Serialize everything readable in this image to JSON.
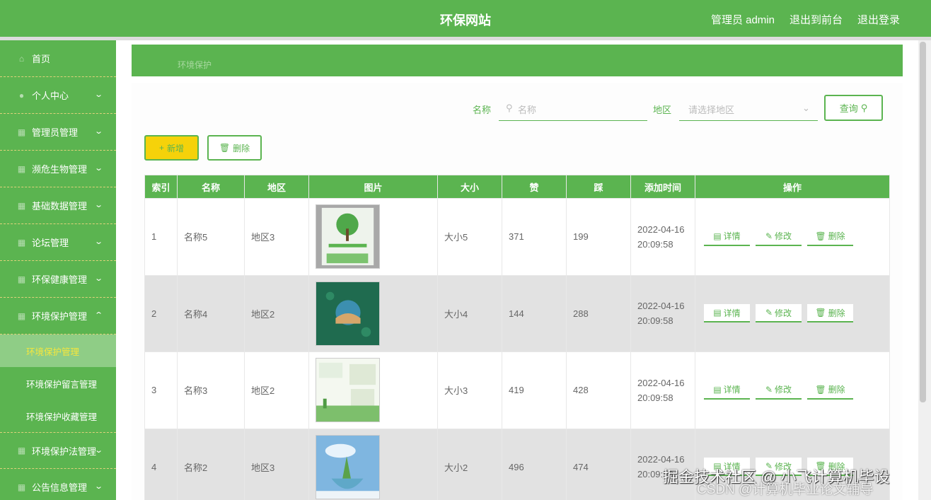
{
  "header": {
    "title": "环保网站",
    "admin": "管理员 admin",
    "to_front": "退出到前台",
    "logout": "退出登录"
  },
  "sidebar": {
    "items": [
      {
        "label": "首页"
      },
      {
        "label": "个人中心"
      },
      {
        "label": "管理员管理"
      },
      {
        "label": "濒危生物管理"
      },
      {
        "label": "基础数据管理"
      },
      {
        "label": "论坛管理"
      },
      {
        "label": "环保健康管理"
      },
      {
        "label": "环境保护管理"
      },
      {
        "label": "环境保护法管理"
      },
      {
        "label": "公告信息管理"
      }
    ],
    "subitems": [
      {
        "label": "环境保护管理"
      },
      {
        "label": "环境保护留言管理"
      },
      {
        "label": "环境保护收藏管理"
      }
    ]
  },
  "breadcrumb": "环境保护",
  "search": {
    "name_label": "名称",
    "name_placeholder": "名称",
    "region_label": "地区",
    "region_placeholder": "请选择地区",
    "query_button": "查询"
  },
  "toolbar": {
    "add_label": "新增",
    "delete_label": "删除"
  },
  "table": {
    "headers": [
      "索引",
      "名称",
      "地区",
      "图片",
      "大小",
      "赞",
      "踩",
      "添加时间",
      "操作"
    ],
    "rows": [
      {
        "index": "1",
        "name": "名称5",
        "region": "地区3",
        "size": "大小5",
        "likes": "371",
        "dislikes": "199",
        "date": "2022-04-16",
        "time": "20:09:58"
      },
      {
        "index": "2",
        "name": "名称4",
        "region": "地区2",
        "size": "大小4",
        "likes": "144",
        "dislikes": "288",
        "date": "2022-04-16",
        "time": "20:09:58"
      },
      {
        "index": "3",
        "name": "名称3",
        "region": "地区2",
        "size": "大小3",
        "likes": "419",
        "dislikes": "428",
        "date": "2022-04-16",
        "time": "20:09:58"
      },
      {
        "index": "4",
        "name": "名称2",
        "region": "地区3",
        "size": "大小2",
        "likes": "496",
        "dislikes": "474",
        "date": "2022-04-16",
        "time": "20:09:58"
      }
    ],
    "ops": {
      "detail": "详情",
      "edit": "修改",
      "delete": "删除"
    }
  },
  "watermark": {
    "line1": "掘金技术社区 @ 小飞计算机毕设",
    "line2": "CSDN @计算机毕业论文辅导"
  },
  "colors": {
    "primary": "#5bb450",
    "accent": "#f5d20a"
  }
}
